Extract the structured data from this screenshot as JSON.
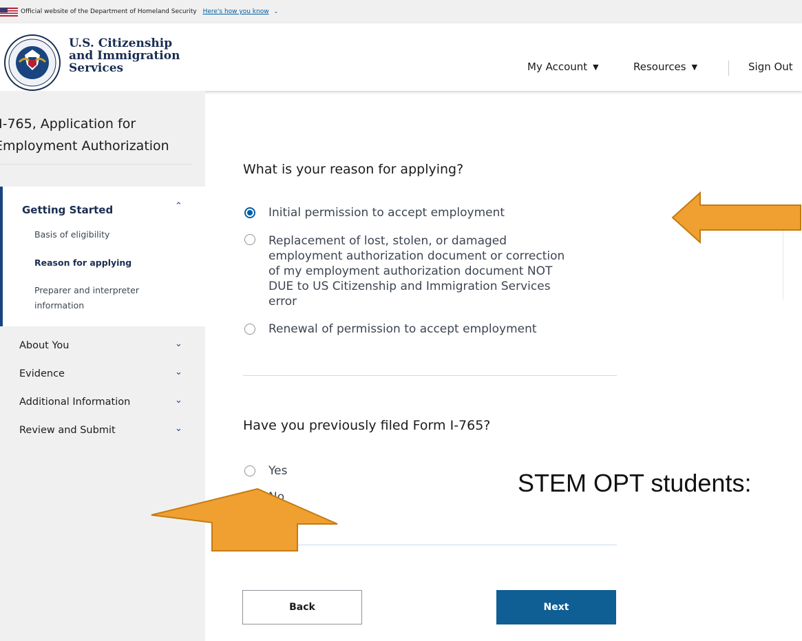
{
  "banner": {
    "text": "Official website of the Department of Homeland Security",
    "link": "Here's how you know"
  },
  "header": {
    "agency_line1": "U.S. Citizenship",
    "agency_line2": "and Immigration",
    "agency_line3": "Services",
    "nav": {
      "my_account": "My Account",
      "resources": "Resources",
      "sign_out": "Sign Out"
    }
  },
  "sidebar": {
    "form_title_line1": "I-765, Application for",
    "form_title_line2": "Employment Authorization",
    "active_section": {
      "title": "Getting Started",
      "items": [
        {
          "label": "Basis of eligibility"
        },
        {
          "label": "Reason for applying"
        },
        {
          "label_line1": "Preparer and interpreter",
          "label_line2": "information"
        }
      ]
    },
    "sections": [
      {
        "label": "About You"
      },
      {
        "label": "Evidence"
      },
      {
        "label": "Additional Information"
      },
      {
        "label": "Review and Submit"
      }
    ]
  },
  "main": {
    "question1": {
      "heading": "What is your reason for applying?",
      "options": [
        {
          "lines": [
            "Initial permission to accept employment"
          ],
          "selected": true
        },
        {
          "lines": [
            "Replacement of lost, stolen, or damaged",
            "employment authorization document or correction",
            "of my employment authorization document NOT",
            "DUE to US Citizenship and Immigration Services",
            "error"
          ],
          "selected": false
        },
        {
          "lines": [
            "Renewal of permission to accept employment"
          ],
          "selected": false
        }
      ]
    },
    "question2": {
      "heading": "Have you previously filed Form I-765?",
      "options": [
        {
          "label": "Yes",
          "selected": false
        },
        {
          "label": "No",
          "selected": false
        }
      ]
    },
    "buttons": {
      "back": "Back",
      "next": "Next"
    }
  },
  "annotation": {
    "text": "STEM OPT students:"
  },
  "colors": {
    "arrow_fill": "#F0A030",
    "arrow_stroke": "#C47A10",
    "next_button": "#0F5E94",
    "agency_text": "#1A2D52",
    "radio_selected": "#005EA2"
  },
  "icons": [
    "us-flag-icon",
    "dhs-seal-icon",
    "caret-down-icon",
    "chevron-up-icon",
    "chevron-down-icon",
    "arrow-left-icon",
    "arrow-up-icon"
  ]
}
